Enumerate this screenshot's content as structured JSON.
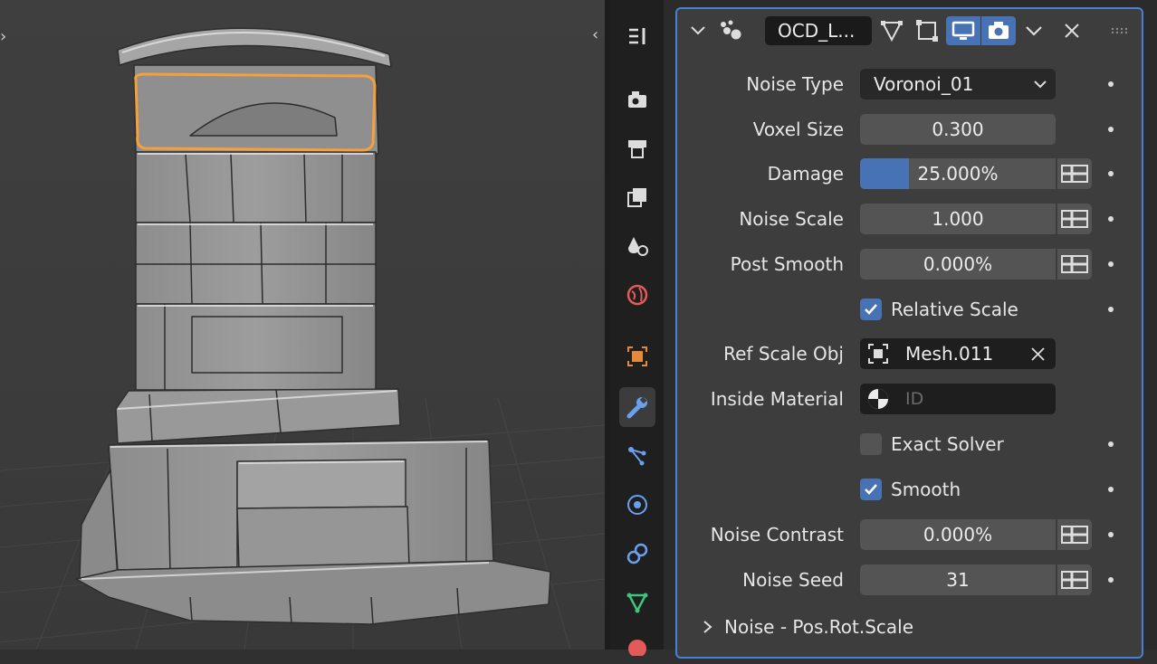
{
  "modifier": {
    "name": "OCD_L...",
    "icons": [
      "modifier-type-icon",
      "edit-mode-icon",
      "cage-icon",
      "realtime-icon",
      "render-icon",
      "chevron-down-icon",
      "close-icon",
      "drag-handle-icon"
    ]
  },
  "tabs": [
    "tool-icon",
    "render-icon",
    "output-icon",
    "view-layer-icon",
    "scene-icon",
    "world-icon",
    "object-icon",
    "modifier-icon",
    "particles-icon",
    "physics-icon",
    "constraints-icon",
    "data-icon",
    "material-icon"
  ],
  "active_tab": "modifier-icon",
  "properties": {
    "noise_type": {
      "label": "Noise Type",
      "value": "Voronoi_01"
    },
    "voxel_size": {
      "label": "Voxel Size",
      "value": "0.300"
    },
    "damage": {
      "label": "Damage",
      "value": "25.000%",
      "fraction": 0.25
    },
    "noise_scale": {
      "label": "Noise Scale",
      "value": "1.000"
    },
    "post_smooth": {
      "label": "Post Smooth",
      "value": "0.000%"
    },
    "relative_scale": {
      "label": "Relative Scale",
      "checked": true
    },
    "ref_scale_obj": {
      "label": "Ref Scale Obj",
      "value": "Mesh.011"
    },
    "inside_material": {
      "label": "Inside Material",
      "placeholder": "ID"
    },
    "exact_solver": {
      "label": "Exact Solver",
      "checked": false
    },
    "smooth": {
      "label": "Smooth",
      "checked": true
    },
    "noise_contrast": {
      "label": "Noise Contrast",
      "value": "0.000%"
    },
    "noise_seed": {
      "label": "Noise Seed",
      "value": "31"
    }
  },
  "subpanel": {
    "label": "Noise - Pos.Rot.Scale"
  },
  "colors": {
    "accent": "#4772b3",
    "selection_outline": "#f5a03a",
    "panel_border": "#4a7fd6"
  }
}
